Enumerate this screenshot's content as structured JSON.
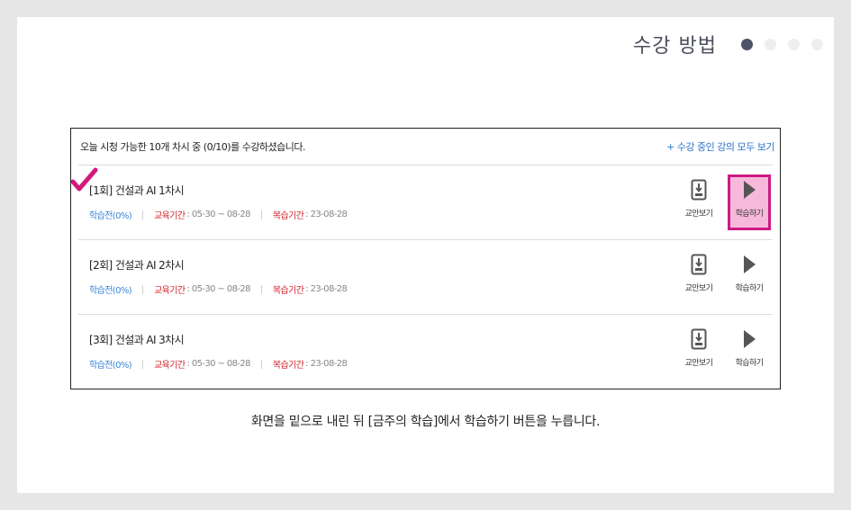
{
  "header": {
    "title": "수강 방법",
    "pager": [
      {
        "name": "page-dot-1",
        "active": true
      },
      {
        "name": "page-dot-2",
        "active": false
      },
      {
        "name": "page-dot-3",
        "active": false
      },
      {
        "name": "page-dot-4",
        "active": false
      }
    ]
  },
  "panel": {
    "notice": "오늘 시청 가능한 10개 차시 중 (0/10)를 수강하셨습니다.",
    "view_all": "+ 수강 중인 강의 모두 보기",
    "rows": [
      {
        "title": "[1회] 건설과 AI 1차시",
        "status": "학습전(0%)",
        "edu_label": "교육기간",
        "edu_value": ": 05-30 ~ 08-28",
        "review_label": "복습기간",
        "review_value": ": 23-08-28",
        "notes_label": "교안보기",
        "study_label": "학습하기"
      },
      {
        "title": "[2회] 건설과 AI 2차시",
        "status": "학습전(0%)",
        "edu_label": "교육기간",
        "edu_value": ": 05-30 ~ 08-28",
        "review_label": "복습기간",
        "review_value": ": 23-08-28",
        "notes_label": "교안보기",
        "study_label": "학습하기"
      },
      {
        "title": "[3회] 건설과 AI 3차시",
        "status": "학습전(0%)",
        "edu_label": "교육기간",
        "edu_value": ": 05-30 ~ 08-28",
        "review_label": "복습기간",
        "review_value": ": 23-08-28",
        "notes_label": "교안보기",
        "study_label": "학습하기"
      }
    ]
  },
  "caption": "화면을 밑으로 내린 뒤 [금주의 학습]에서 학습하기 버튼을 누릅니다.",
  "colors": {
    "highlight_fill": "#f7b9db",
    "highlight_border": "#cc1b83",
    "checkmark": "#d4197a",
    "status_blue": "#3a86d6",
    "label_red": "#d0202a",
    "link_blue": "#2c73c9",
    "dot_active": "#4d5467",
    "dot_inactive": "#eeeef1"
  },
  "icons": {
    "notes": "document-download-icon",
    "study": "play-icon",
    "marker": "checkmark-icon"
  }
}
